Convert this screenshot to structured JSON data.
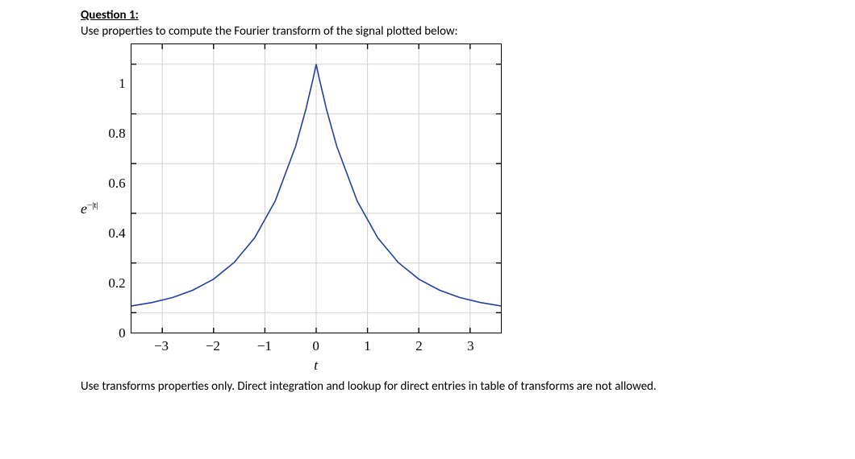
{
  "question": {
    "title": "Question 1:",
    "prompt": "Use properties to compute the Fourier transform of the signal plotted below:",
    "footer": "Use transforms properties only. Direct integration and lookup for direct entries in table of transforms are not allowed."
  },
  "chart_data": {
    "type": "line",
    "title": "",
    "xlabel": "t",
    "ylabel_html": "e<span class=\"sup\">−|t|</span>",
    "xlim": [
      -3.6,
      3.6
    ],
    "ylim": [
      -0.08,
      1.08
    ],
    "xticks": [
      -3,
      -2,
      -1,
      0,
      1,
      2,
      3
    ],
    "yticks": [
      0,
      0.2,
      0.4,
      0.6,
      0.8,
      1
    ],
    "xtick_labels": [
      "−3",
      "−2",
      "−1",
      "0",
      "1",
      "2",
      "3"
    ],
    "ytick_labels": [
      "0",
      "0.2",
      "0.4",
      "0.6",
      "0.8",
      "1"
    ],
    "series": [
      {
        "name": "exp(-|t|)",
        "x": [
          -3.6,
          -3.2,
          -2.8,
          -2.4,
          -2.0,
          -1.6,
          -1.2,
          -0.8,
          -0.4,
          -0.2,
          -0.05,
          0,
          0.05,
          0.2,
          0.4,
          0.8,
          1.2,
          1.6,
          2.0,
          2.4,
          2.8,
          3.2,
          3.6
        ],
        "y": [
          0.027,
          0.041,
          0.061,
          0.091,
          0.135,
          0.202,
          0.301,
          0.449,
          0.67,
          0.819,
          0.951,
          1.0,
          0.951,
          0.819,
          0.67,
          0.449,
          0.301,
          0.202,
          0.135,
          0.091,
          0.061,
          0.041,
          0.027
        ]
      }
    ]
  }
}
